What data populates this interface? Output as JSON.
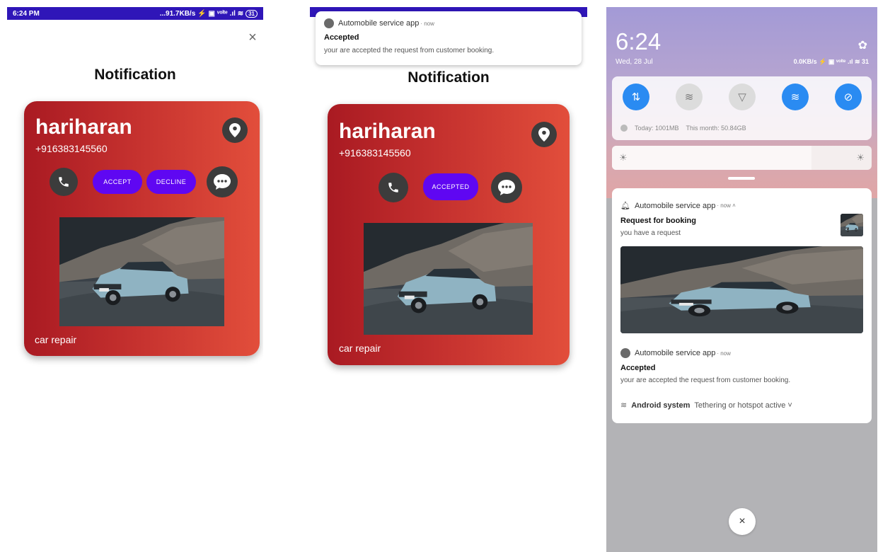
{
  "screen1": {
    "status": {
      "time": "6:24 PM",
      "net": "...91.7KB/s",
      "signal_text": "⚡ ▣ ᵛᵒˡᵗᵉ .ıl ≋",
      "battery": "31"
    },
    "close_icon": "×",
    "title": "Notification",
    "card": {
      "name": "hariharan",
      "phone": "+916383145560",
      "accept_label": "ACCEPT",
      "decline_label": "DECLINE",
      "caption": "car repair"
    }
  },
  "screen2": {
    "headsup": {
      "app": "Automobile service app",
      "time": " · now",
      "title": "Accepted",
      "body": "your are accepted the request from customer booking."
    },
    "title": "Notification",
    "card": {
      "name": "hariharan",
      "phone": "+916383145560",
      "accepted_label": "ACCEPTED",
      "caption": "car repair"
    }
  },
  "screen3": {
    "clock": "6:24",
    "date": "Wed, 28 Jul",
    "status": "0.0KB/s ⚡ ▣ ᵛᵒˡᵗᵉ .ıl ≋ 31",
    "usage_today": "Today: 1001MB",
    "usage_month": "This month: 50.84GB",
    "notif1": {
      "app": "Automobile service app",
      "time": " · now ˄",
      "title": "Request for booking",
      "body": "you have a request"
    },
    "notif2": {
      "app": "Automobile service app",
      "time": " · now",
      "title": "Accepted",
      "body": "your are accepted the request from customer booking."
    },
    "system": {
      "app": "Android system",
      "text": "Tethering or hotspot active ˅"
    },
    "close_icon": "×"
  },
  "colors": {
    "status_bar": "#2f16b8",
    "card_start": "#a91a22",
    "card_end": "#e24e3b",
    "pill": "#5f07f2",
    "qs_on": "#2a8bf2"
  },
  "icons": [
    "close-icon",
    "location-pin-icon",
    "phone-icon",
    "chat-icon",
    "gear-icon",
    "bell-icon",
    "wifi-icon",
    "flashlight-icon",
    "data-icon",
    "sun-icon"
  ]
}
